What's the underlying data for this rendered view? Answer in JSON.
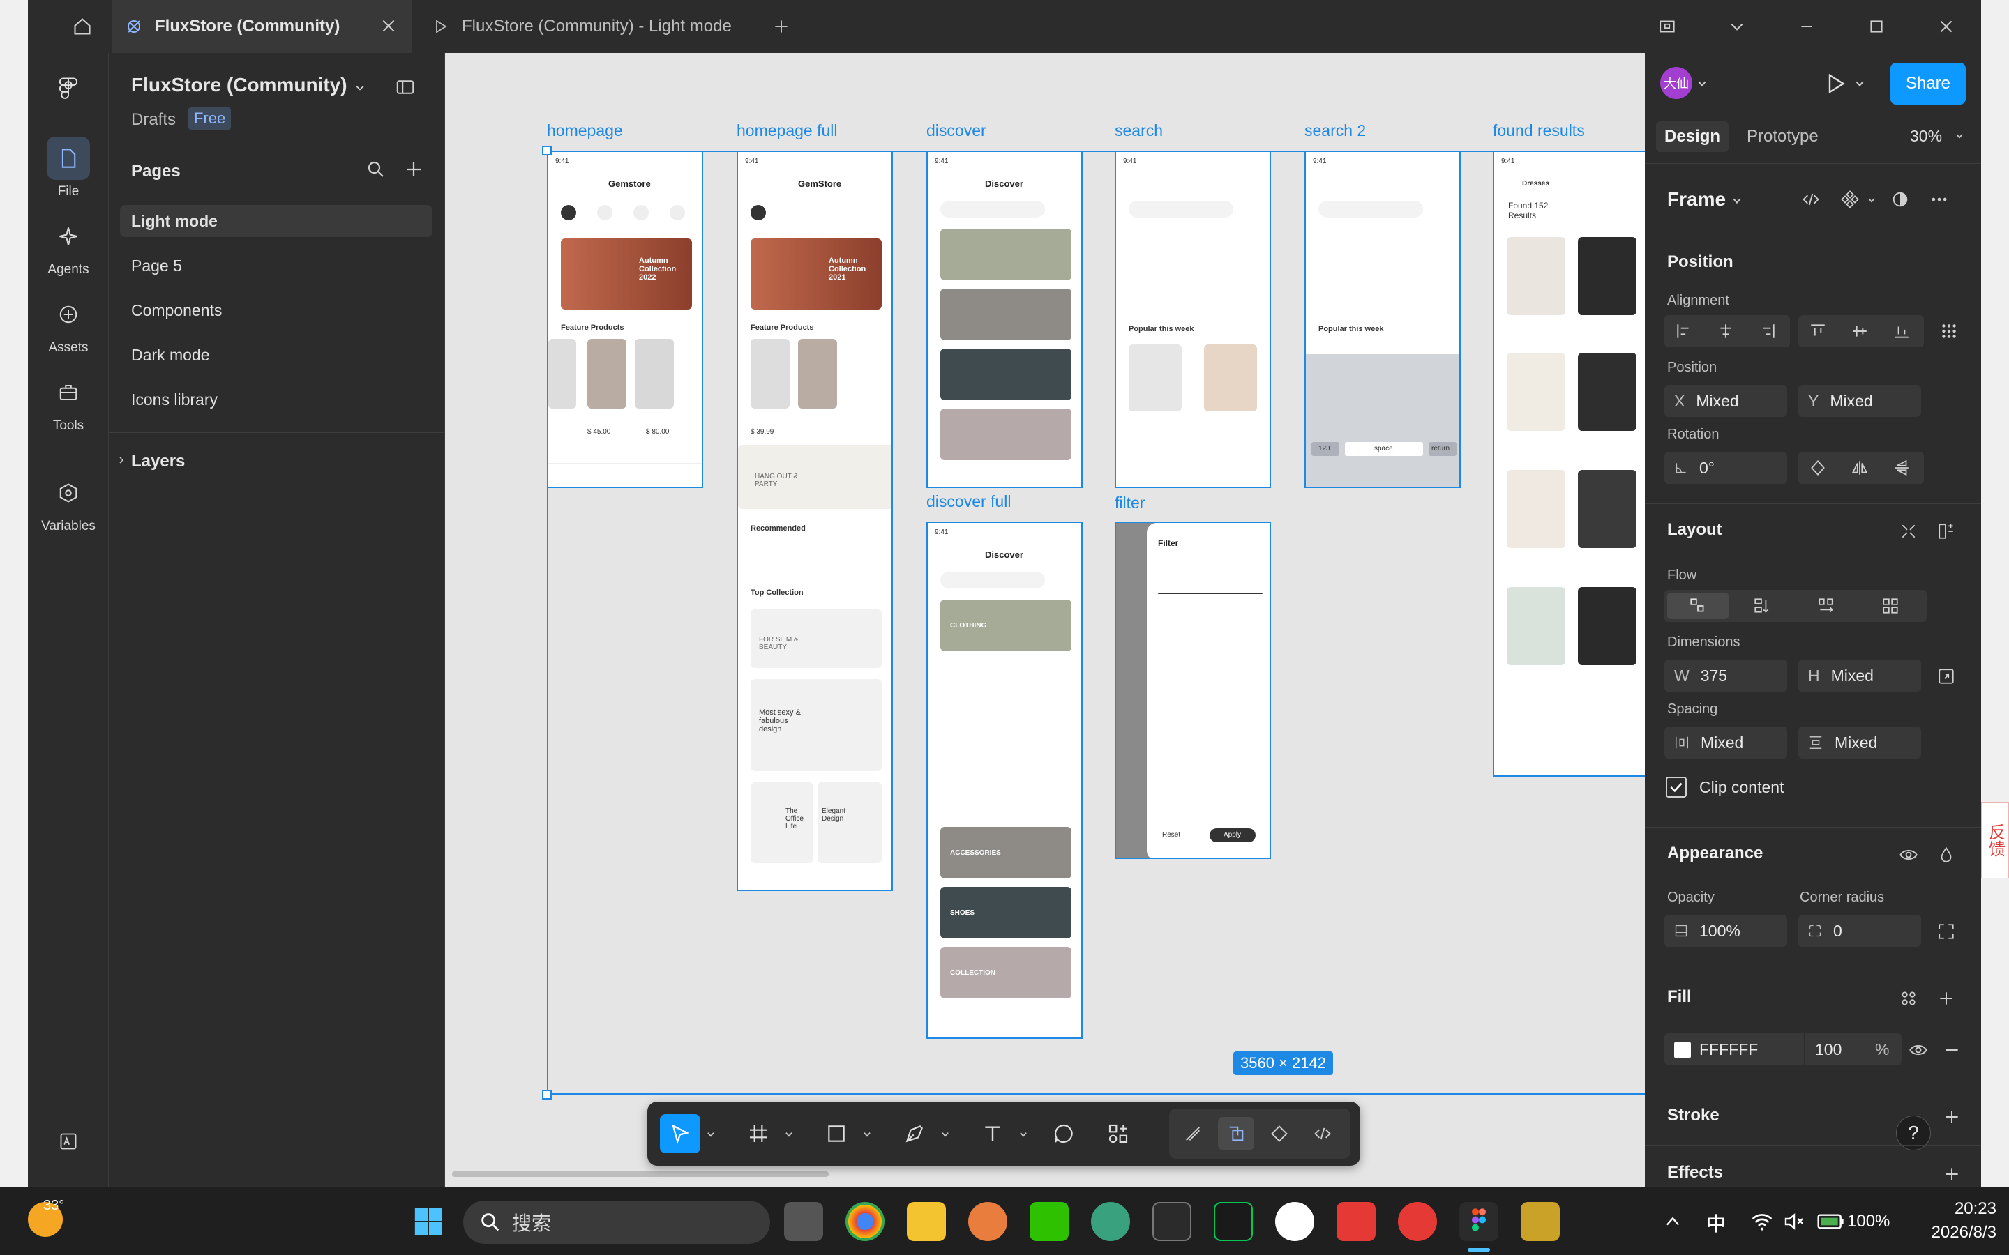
{
  "tabs": {
    "active": "FluxStore (Community)",
    "second": "FluxStore (Community) - Light mode"
  },
  "rail": {
    "file": "File",
    "agents": "Agents",
    "assets": "Assets",
    "tools": "Tools",
    "variables": "Variables"
  },
  "file_panel": {
    "title": "FluxStore (Community)",
    "drafts": "Drafts",
    "plan": "Free",
    "pages_heading": "Pages",
    "pages": [
      "Light mode",
      "Page 5",
      "Components",
      "Dark mode",
      "Icons library"
    ],
    "layers": "Layers"
  },
  "canvas": {
    "frames": {
      "homepage": "homepage",
      "homepage_full": "homepage full",
      "discover": "discover",
      "search": "search",
      "search2": "search 2",
      "found_results": "found results",
      "discover_full": "discover full",
      "filter": "filter"
    },
    "selection_size": "3560 × 2142",
    "mock": {
      "time": "9:41",
      "brand": "Gemstore",
      "brand2": "GemStore",
      "discover": "Discover",
      "autumn1": "Autumn Collection 2022",
      "autumn2": "Autumn Collection 2021",
      "feature": "Feature Products",
      "recommended": "Recommended",
      "top_collection": "Top Collection",
      "popular": "Popular this week",
      "filter": "Filter",
      "found": "Found 152 Results",
      "dresses": "Dresses",
      "clothing": "CLOTHING",
      "accessories": "ACCESSORIES",
      "shoes": "SHOES",
      "collection": "COLLECTION",
      "hangout": "HANG OUT & PARTY",
      "forslim": "FOR SLIM & BEAUTY",
      "mostsexy": "Most sexy & fabulous design",
      "office": "The Office Life",
      "elegant": "Elegant Design",
      "price1": "$ 45.00",
      "price2": "$ 80.00",
      "price3": "$ 39.99",
      "apply": "Apply",
      "reset": "Reset",
      "space": "space",
      "return": "return",
      "n123": "123"
    }
  },
  "right_panel": {
    "tabs": [
      "Design",
      "Prototype"
    ],
    "zoom": "30%",
    "share": "Share",
    "avatar": "大仙",
    "frame": "Frame",
    "position_h": "Position",
    "alignment": "Alignment",
    "position": "Position",
    "x_label": "X",
    "x_value": "Mixed",
    "y_label": "Y",
    "y_value": "Mixed",
    "rotation": "Rotation",
    "rotation_value": "0°",
    "layout_h": "Layout",
    "flow": "Flow",
    "dimensions": "Dimensions",
    "w_label": "W",
    "w_value": "375",
    "h_label": "H",
    "h_value": "Mixed",
    "spacing": "Spacing",
    "spacing_h": "Mixed",
    "spacing_v": "Mixed",
    "clip": "Clip content",
    "appearance_h": "Appearance",
    "opacity": "Opacity",
    "opacity_value": "100%",
    "corner": "Corner radius",
    "corner_value": "0",
    "fill_h": "Fill",
    "fill_hex": "FFFFFF",
    "fill_opacity": "100",
    "fill_pct": "%",
    "stroke_h": "Stroke",
    "effects_h": "Effects",
    "help": "?"
  },
  "taskbar": {
    "weather": "33°",
    "search": "搜索",
    "lang": "中",
    "battery": "100%",
    "time": "20:23",
    "date": "2026/8/3",
    "side_text": "反馈"
  },
  "colors": {
    "accent": "#0d99ff",
    "selection": "#1e88e5",
    "panel": "#2c2c2c"
  }
}
